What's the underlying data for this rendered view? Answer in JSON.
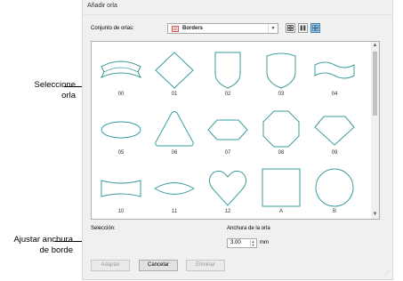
{
  "dialog": {
    "title": "Añadir orla",
    "set_label": "Conjunto de orlas:",
    "set_value": "Borders",
    "selection_label": "Selección:",
    "width_label": "Anchura de la orla",
    "width_value": "3.00",
    "width_unit": "mm",
    "buttons": {
      "adapt": "Adaptar",
      "cancel": "Cancelar",
      "delete": "Eliminar"
    }
  },
  "borders": [
    {
      "caption": "00",
      "icon": "banner-icon"
    },
    {
      "caption": "01",
      "icon": "diamond-icon"
    },
    {
      "caption": "02",
      "icon": "shield-icon"
    },
    {
      "caption": "03",
      "icon": "crest-icon"
    },
    {
      "caption": "04",
      "icon": "wave-banner-icon"
    },
    {
      "caption": "05",
      "icon": "ellipse-icon"
    },
    {
      "caption": "06",
      "icon": "triangle-icon"
    },
    {
      "caption": "07",
      "icon": "hexagon-icon"
    },
    {
      "caption": "08",
      "icon": "octagon-icon"
    },
    {
      "caption": "09",
      "icon": "gem-icon"
    },
    {
      "caption": "10",
      "icon": "concave-rect-icon"
    },
    {
      "caption": "11",
      "icon": "lens-icon"
    },
    {
      "caption": "12",
      "icon": "heart-icon"
    },
    {
      "caption": "A",
      "icon": "square-icon"
    },
    {
      "caption": "B",
      "icon": "circle-icon"
    }
  ],
  "callouts": {
    "select_border": [
      "Seleccione",
      "orla"
    ],
    "adjust_width": [
      "Ajustar anchura",
      "de borde"
    ]
  },
  "colors": {
    "shape_stroke": "#3b9c9c",
    "set_icon": "#d9534f"
  }
}
